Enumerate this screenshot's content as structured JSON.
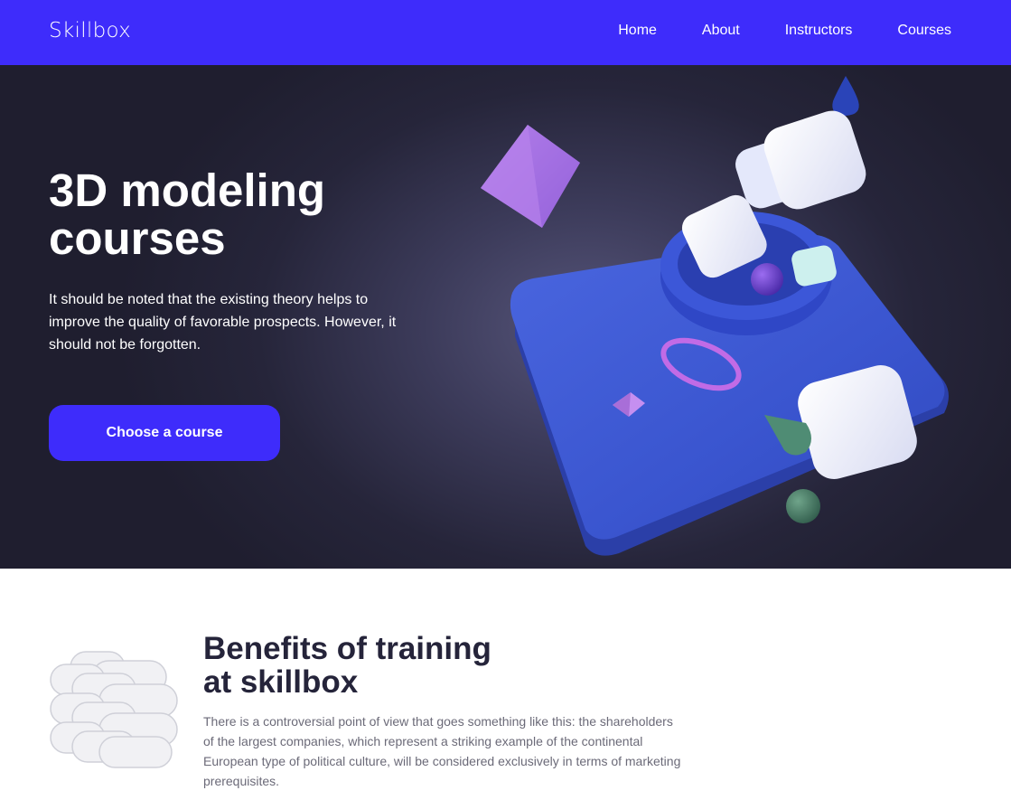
{
  "header": {
    "logo": "Skillbox",
    "nav": [
      {
        "label": "Home"
      },
      {
        "label": "About"
      },
      {
        "label": "Instructors"
      },
      {
        "label": "Courses"
      }
    ]
  },
  "hero": {
    "title": "3D modeling\ncourses",
    "text": "It should be noted that the existing theory helps to improve the quality of favorable prospects. However, it should not be forgotten.",
    "cta_label": "Choose a course"
  },
  "benefits": {
    "title": "Benefits of training\nat skillbox",
    "text": "There is a controversial point of view that goes something like this: the shareholders of the largest companies, which represent a striking example of the continental European type of political culture, will be considered exclusively in terms of marketing prerequisites."
  },
  "colors": {
    "brand": "#3e2cfb",
    "hero_bg": "#26253a",
    "heading_dark": "#25243a",
    "body_gray": "#6b6a78"
  }
}
